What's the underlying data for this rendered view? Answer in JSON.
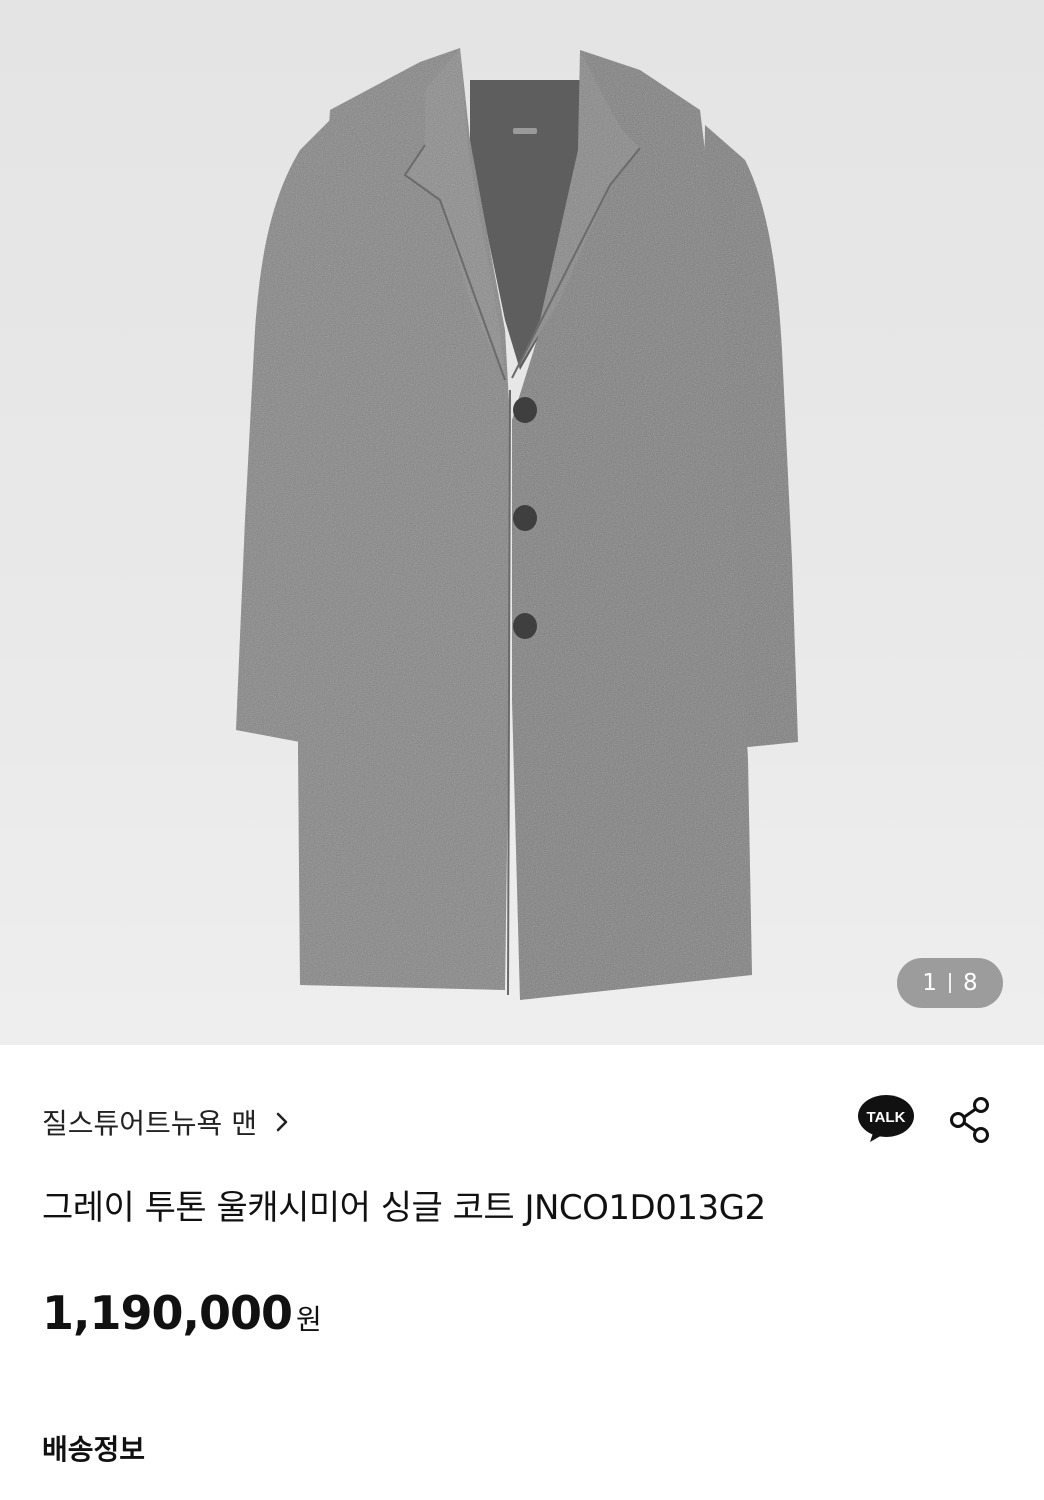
{
  "product": {
    "image_alt": "gray two-tone wool cashmere single coat",
    "pager": {
      "current": "1",
      "total": "8"
    },
    "brand": "질스튜어트뉴욕 맨",
    "title": "그레이 투톤 울캐시미어 싱글 코트 JNCO1D013G2",
    "price": {
      "amount": "1,190,000",
      "unit": "원"
    }
  },
  "actions": {
    "talk_label": "TALK",
    "talk_icon": "kakao-talk-icon",
    "share_icon": "share-icon",
    "brand_chevron_icon": "chevron-right-icon"
  },
  "sections": {
    "shipping_label": "배송정보"
  },
  "colors": {
    "coat": "#858585",
    "background": "#e8e8e8",
    "pager_bg": "#8c8c8c",
    "text": "#111111"
  }
}
